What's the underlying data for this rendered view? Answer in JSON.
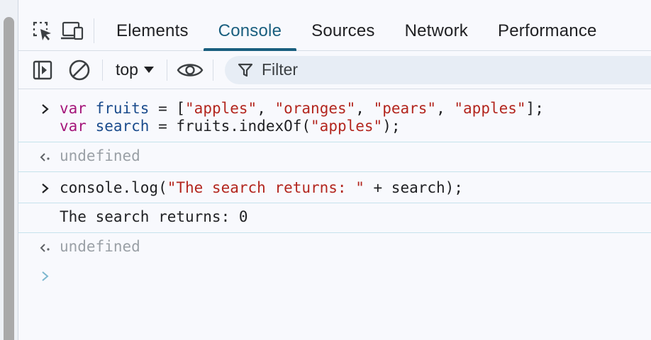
{
  "tabs": {
    "elements": "Elements",
    "console": "Console",
    "sources": "Sources",
    "network": "Network",
    "performance": "Performance"
  },
  "toolbar": {
    "context": "top",
    "filter_placeholder": "Filter"
  },
  "console": {
    "entry1": {
      "line1": {
        "kw": "var",
        "name": "fruits",
        "mid": " = [",
        "s1": "\"apples\"",
        "c1": ", ",
        "s2": "\"oranges\"",
        "c2": ", ",
        "s3": "\"pears\"",
        "c3": ", ",
        "s4": "\"apples\"",
        "end": "];"
      },
      "line2": {
        "kw": "var",
        "name": "search",
        "mid": " = fruits.indexOf(",
        "s1": "\"apples\"",
        "end": ");"
      },
      "result": "undefined"
    },
    "entry2": {
      "code_pre": "console.log(",
      "code_str": "\"The search returns: \"",
      "code_post": " + search);",
      "log_output": "The search returns: 0",
      "result": "undefined"
    }
  },
  "icons": {
    "inspect": "inspect-element-icon",
    "device": "device-toolbar-icon",
    "sidebar": "sidebar-toggle-icon",
    "clear": "clear-console-icon",
    "eye": "live-expression-eye-icon",
    "filter": "filter-funnel-icon",
    "input_prompt": "chevron-right-icon",
    "return_prompt": "return-arrow-icon"
  },
  "colors": {
    "accent": "#1a5f7f",
    "keyword": "#a5167a",
    "string": "#b3261e",
    "undefined": "#9aa0a6"
  }
}
